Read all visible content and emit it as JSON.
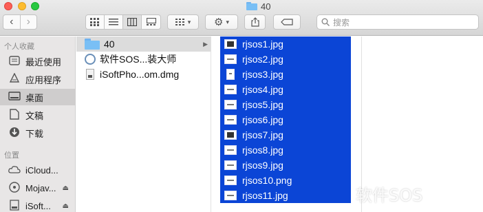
{
  "window": {
    "title": "40",
    "search_placeholder": "搜索"
  },
  "toolbar": {
    "back": "‹",
    "forward": "›",
    "view_icons": [
      "icon-view-icon",
      "list-view-icon",
      "column-view-icon",
      "gallery-view-icon"
    ],
    "group_label": "▾",
    "action_label": "▾"
  },
  "sidebar": {
    "favorites_header": "个人收藏",
    "favorites": [
      {
        "label": "最近使用",
        "icon": "clock-icon"
      },
      {
        "label": "应用程序",
        "icon": "applications-icon"
      },
      {
        "label": "桌面",
        "icon": "desktop-icon",
        "selected": true
      },
      {
        "label": "文稿",
        "icon": "document-icon"
      },
      {
        "label": "下载",
        "icon": "download-icon"
      }
    ],
    "locations_header": "位置",
    "locations": [
      {
        "label": "iCloud...",
        "icon": "cloud-icon"
      },
      {
        "label": "Mojav...",
        "icon": "disk-icon"
      },
      {
        "label": "iSoft...",
        "icon": "disk-icon"
      }
    ]
  },
  "column1": {
    "items": [
      {
        "label": "40",
        "type": "folder",
        "selected": true
      },
      {
        "label": "软件SOS...装大师",
        "type": "app"
      },
      {
        "label": "iSoftPho...om.dmg",
        "type": "dmg"
      }
    ]
  },
  "column2": {
    "items": [
      "rjsos1.jpg",
      "rjsos2.jpg",
      "rjsos3.jpg",
      "rjsos4.jpg",
      "rjsos5.jpg",
      "rjsos6.jpg",
      "rjsos7.jpg",
      "rjsos8.jpg",
      "rjsos9.jpg",
      "rjsos10.png",
      "rjsos11.jpg"
    ]
  },
  "watermark": "软件SOS"
}
